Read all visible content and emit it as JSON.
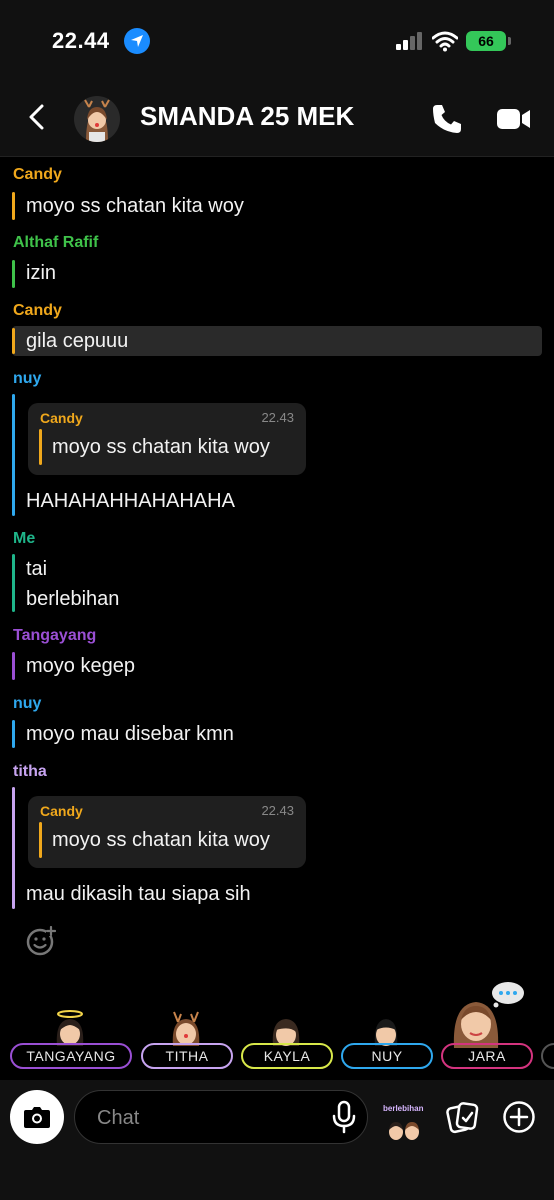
{
  "status": {
    "time": "22.44",
    "battery": "66"
  },
  "header": {
    "title": "SMANDA 25 MEK"
  },
  "messages": [
    {
      "sender": "Candy",
      "lines": [
        "moyo ss chatan kita woy"
      ],
      "color": "#f0a81c"
    },
    {
      "sender": "Althaf Rafif",
      "lines": [
        "izin"
      ],
      "color": "#3fc24a"
    },
    {
      "sender": "Candy",
      "lines": [
        "gila cepuuu"
      ],
      "color": "#f0a81c",
      "highlighted": true
    },
    {
      "sender": "nuy",
      "color": "#2fa8ee",
      "quote": {
        "sender": "Candy",
        "time": "22.43",
        "text": "moyo ss chatan kita woy"
      },
      "lines": [
        "HAHAHAHHAHAHAHA"
      ]
    },
    {
      "sender": "Me",
      "lines": [
        "tai",
        "berlebihan"
      ],
      "color": "#1fb58a"
    },
    {
      "sender": "Tangayang",
      "lines": [
        "moyo kegep"
      ],
      "color": "#9a4fd4"
    },
    {
      "sender": "nuy",
      "lines": [
        "moyo mau disebar kmn"
      ],
      "color": "#2fa8ee"
    },
    {
      "sender": "titha",
      "color": "#c7a4f0",
      "quote": {
        "sender": "Candy",
        "time": "22.43",
        "text": "moyo ss chatan kita woy"
      },
      "lines": [
        "mau dikasih tau siapa sih"
      ]
    }
  ],
  "friends": [
    {
      "name": "TANGAYANG",
      "color": "#9a4fd4"
    },
    {
      "name": "TITHA",
      "color": "#c7a4f0"
    },
    {
      "name": "KAYLA",
      "color": "#d8e84a"
    },
    {
      "name": "NUY",
      "color": "#2fa8ee"
    },
    {
      "name": "JARA",
      "color": "#d4347f"
    }
  ],
  "composer": {
    "placeholder": "Chat",
    "sticker_label": "berlebihan"
  },
  "icons": {
    "status": [
      "location-arrow-icon",
      "cellular-signal-icon",
      "wifi-icon",
      "battery-icon"
    ],
    "header": [
      "back-chevron-icon",
      "group-avatar-icon",
      "phone-call-icon",
      "video-call-icon"
    ],
    "chat": [
      "add-reaction-icon"
    ],
    "composer": [
      "camera-icon",
      "microphone-icon",
      "sticker-icon",
      "gallery-icon",
      "plus-icon"
    ]
  },
  "colors": {
    "background": "#000000",
    "panel": "#111111",
    "battery": "#34c759",
    "location": "#1a8cff"
  }
}
